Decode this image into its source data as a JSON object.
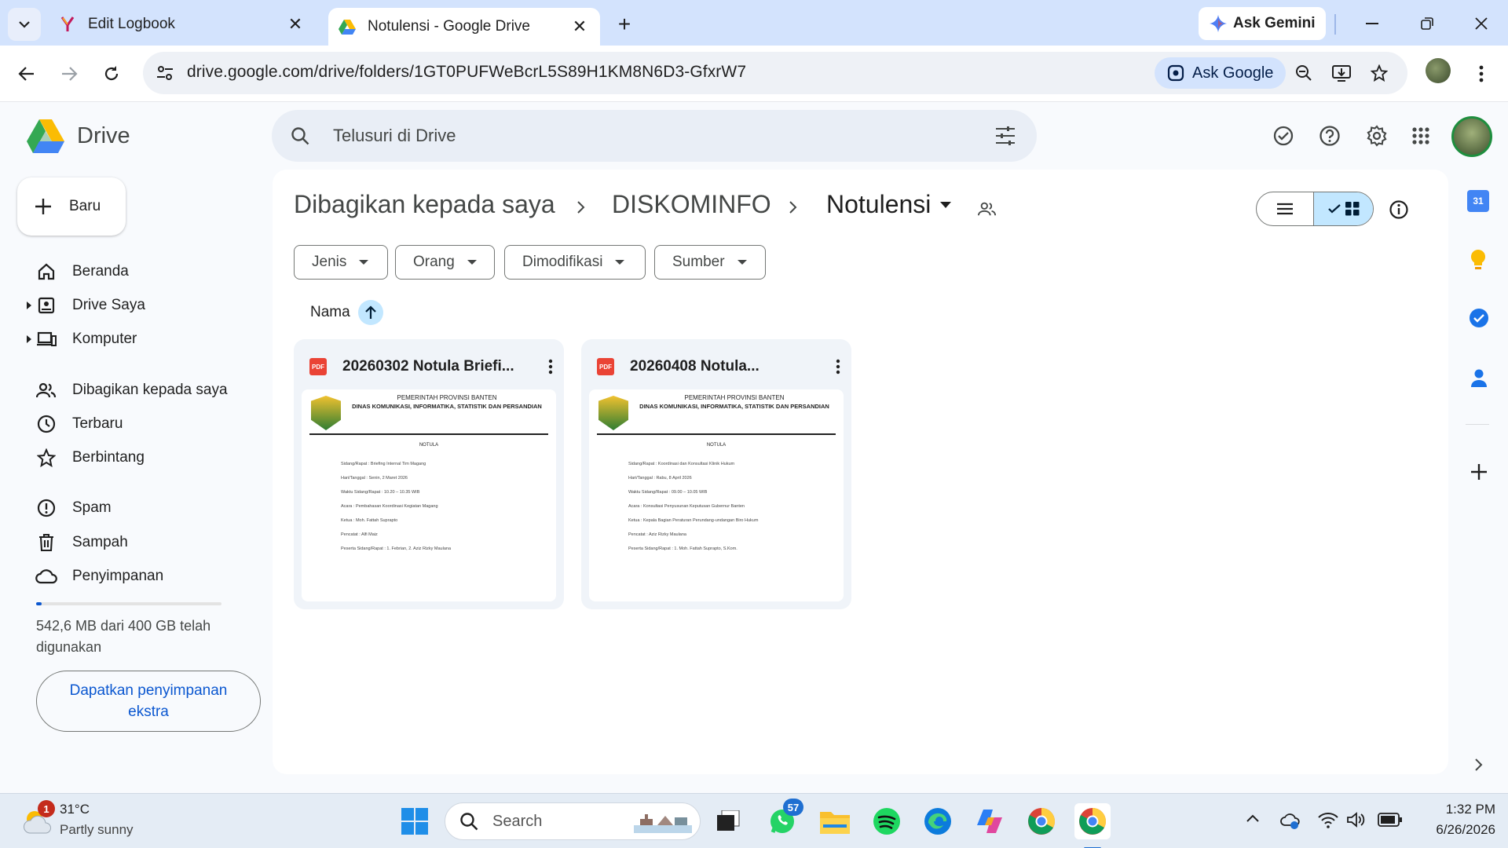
{
  "browser": {
    "tabs": [
      {
        "title": "Edit Logbook",
        "active": false
      },
      {
        "title": "Notulensi - Google Drive",
        "active": true
      }
    ],
    "new_tab": "+",
    "ask_gemini": "Ask Gemini",
    "url": "drive.google.com/drive/folders/1GT0PUFWeBcrL5S89H1KM8N6D3-GfxrW7",
    "ask_google": "Ask Google"
  },
  "drive": {
    "logo_text": "Drive",
    "search_placeholder": "Telusuri di Drive",
    "new_button": "Baru",
    "nav": [
      {
        "label": "Beranda",
        "icon": "home-icon"
      },
      {
        "label": "Drive Saya",
        "icon": "my-drive-icon"
      },
      {
        "label": "Komputer",
        "icon": "computer-icon"
      },
      {
        "label": "Dibagikan kepada saya",
        "icon": "shared-icon"
      },
      {
        "label": "Terbaru",
        "icon": "clock-icon"
      },
      {
        "label": "Berbintang",
        "icon": "star-icon"
      },
      {
        "label": "Spam",
        "icon": "spam-icon"
      },
      {
        "label": "Sampah",
        "icon": "trash-icon"
      },
      {
        "label": "Penyimpanan",
        "icon": "cloud-icon"
      }
    ],
    "storage_used_fraction": 0.0014,
    "storage_text": "542,6 MB dari 400 GB telah digunakan",
    "storage_button": "Dapatkan penyimpanan ekstra",
    "breadcrumb": [
      "Dibagikan kepada saya",
      "DISKOMINFO",
      "Notulensi"
    ],
    "filters": [
      "Jenis",
      "Orang",
      "Dimodifikasi",
      "Sumber"
    ],
    "sort_label": "Nama",
    "files": [
      {
        "name": "20260302 Notula Briefi...",
        "type": "PDF",
        "doc": {
          "org1": "PEMERINTAH PROVINSI BANTEN",
          "org2": "DINAS KOMUNIKASI, INFORMATIKA, STATISTIK DAN PERSANDIAN",
          "heading": "NOTULA",
          "lines": [
            "Sidang/Rapat : Briefing Internal Tim Magang",
            "Hari/Tanggal : Senin, 2 Maret 2026",
            "Waktu Sidang/Rapat : 10.20 – 10.35 WIB",
            "Acara : Pembahasan Koordinasi Kegiatan Magang",
            "Ketua : Moh. Fattah Suprapto",
            "Pencatat : Alfi Maiz",
            "Peserta Sidang/Rapat : 1. Febrian, 2. Aziz Rizky Maulana"
          ]
        }
      },
      {
        "name": "20260408 Notula...",
        "type": "PDF",
        "doc": {
          "org1": "PEMERINTAH PROVINSI BANTEN",
          "org2": "DINAS KOMUNIKASI, INFORMATIKA, STATISTIK DAN PERSANDIAN",
          "heading": "NOTULA",
          "lines": [
            "Sidang/Rapat : Koordinasi dan Konsultasi Klinik Hukum",
            "Hari/Tanggal : Rabu, 8 April 2026",
            "Waktu Sidang/Rapat : 09.00 – 10.05 WIB",
            "Acara : Konsultasi Penyusunan Keputusan Gubernur Banten",
            "Ketua : Kepala Bagian Peraturan Perundang-undangan Biro Hukum",
            "Pencatat : Aziz Rizky Maulana",
            "Peserta Sidang/Rapat : 1. Moh. Fattah Suprapto, S.Kom."
          ]
        }
      }
    ]
  },
  "taskbar": {
    "weather_temp": "31°C",
    "weather_desc": "Partly sunny",
    "weather_badge": "1",
    "search_placeholder": "Search",
    "whatsapp_badge": "57",
    "time": "1:32 PM",
    "date": "6/26/2026"
  },
  "colors": {
    "accent": "#0b57d0",
    "chrome_bg": "#d3e3fd",
    "pdf_red": "#ea4335"
  }
}
